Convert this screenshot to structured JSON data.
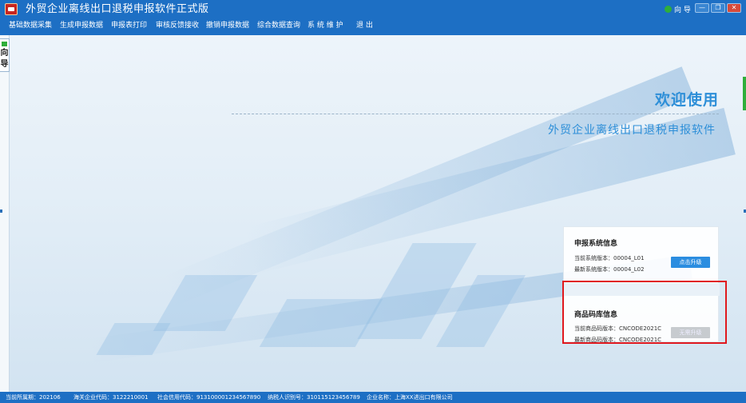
{
  "window": {
    "title": "外贸企业离线出口退税申报软件正式版",
    "wizard_label": "向 导",
    "controls": [
      "—",
      "❐",
      "✕"
    ]
  },
  "menu": [
    "基础数据采集",
    "生成申报数据",
    "申报表打印",
    "审核反馈接收",
    "撤销申报数据",
    "综合数据查询",
    "系 统 维 护",
    "退  出"
  ],
  "side_wizard": {
    "char1": "向",
    "char2": "导"
  },
  "main": {
    "welcome": "欢迎使用",
    "subtitle": "外贸企业离线出口退税申报软件"
  },
  "system_info": {
    "title": "申报系统信息",
    "current_version": "当前系统版本：00004_L01",
    "latest_version": "最新系统版本：00004_L02",
    "upgrade_button": "点击升级"
  },
  "code_info": {
    "title": "商品码库信息",
    "current_version": "当前商品码版本：CNCODE2021C",
    "latest_version": "最新商品码版本：CNCODE2021C",
    "upgrade_button": "无需升级"
  },
  "status": {
    "period": "当前所属期：202106",
    "customs_code": "海关企业代码：3122210001",
    "credit_code": "社会信用代码：913100001234567890",
    "taxpayer_id": "纳税人识别号：310115123456789",
    "company": "企业名称：上海XX进出口有限公司"
  },
  "colors": {
    "titlebar": "#1d6fc4",
    "accent": "#2e8fd8",
    "highlight": "#e0191e"
  }
}
